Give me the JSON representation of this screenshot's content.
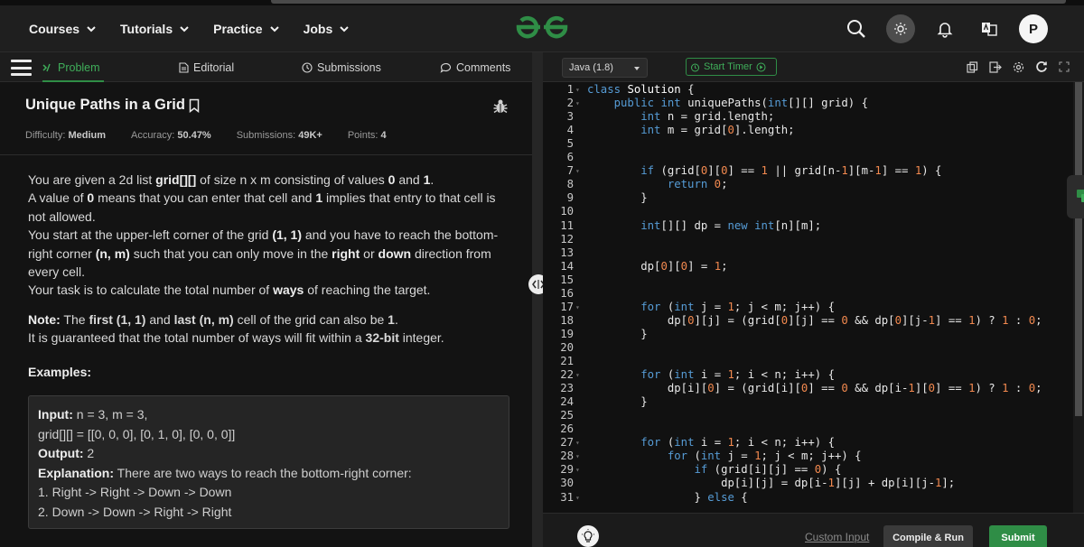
{
  "navbar": {
    "menu": [
      {
        "label": "Courses"
      },
      {
        "label": "Tutorials"
      },
      {
        "label": "Practice"
      },
      {
        "label": "Jobs"
      }
    ],
    "avatar_initial": "P"
  },
  "colors": {
    "brand_green": "#2f8d46",
    "background": "#131313",
    "keyword_blue": "#569cd6",
    "number_orange": "#f2894f"
  },
  "left_tabs": {
    "problem": "Problem",
    "editorial": "Editorial",
    "submissions": "Submissions",
    "comments": "Comments"
  },
  "problem": {
    "title": "Unique Paths in a Grid",
    "meta": {
      "difficulty_label": "Difficulty:",
      "difficulty": "Medium",
      "accuracy_label": "Accuracy:",
      "accuracy": "50.47%",
      "submissions_label": "Submissions:",
      "submissions": "49K+",
      "points_label": "Points:",
      "points": "4"
    },
    "description": {
      "p1": [
        "You are given a 2d list ",
        "grid[][]",
        " of size n x m consisting of values ",
        "0",
        " and ",
        "1",
        "."
      ],
      "p2": [
        "A value of ",
        "0",
        " means that you can enter that cell and ",
        "1",
        " implies that entry to that cell is not allowed."
      ],
      "p3": [
        "You start at the upper-left corner of the grid ",
        "(1, 1)",
        " and you have to reach the bottom-right corner ",
        "(n, m)",
        " such that you can only move in the ",
        "right",
        " or ",
        "down",
        " direction from every cell."
      ],
      "p4": [
        "Your task is to calculate the total number of ",
        "ways",
        " of reaching the target."
      ]
    },
    "note": {
      "label": "Note:",
      "l1": [
        " The ",
        "first (1, 1)",
        " and ",
        "last (n, m)",
        " cell of the grid can also be ",
        "1",
        "."
      ],
      "l2": [
        "It is guaranteed that the total number of ways will fit within a ",
        "32-bit",
        " integer."
      ]
    },
    "examples_heading": "Examples:",
    "example": {
      "input_label": "Input:",
      "input_line1": " n = 3, m = 3,",
      "input_line2": "grid[][] = [[0, 0, 0], [0, 1, 0], [0, 0, 0]]",
      "output_label": "Output:",
      "output_value": " 2",
      "explanation_label": "Explanation:",
      "explanation_text": " There are two ways to reach the bottom-right corner:",
      "way1": "1. Right -> Right -> Down -> Down",
      "way2": "2. Down -> Down -> Right -> Right"
    }
  },
  "editor": {
    "language": "Java (1.8)",
    "timer_label": "Start Timer",
    "lines": [
      {
        "n": "1",
        "fold": true,
        "code": "class Solution {"
      },
      {
        "n": "2",
        "fold": true,
        "code": "    public int uniquePaths(int[][] grid) {"
      },
      {
        "n": "3",
        "fold": false,
        "code": "        int n = grid.length;"
      },
      {
        "n": "4",
        "fold": false,
        "code": "        int m = grid[0].length;"
      },
      {
        "n": "5",
        "fold": false,
        "code": ""
      },
      {
        "n": "6",
        "fold": false,
        "code": ""
      },
      {
        "n": "7",
        "fold": true,
        "code": "        if (grid[0][0] == 1 || grid[n-1][m-1] == 1) {"
      },
      {
        "n": "8",
        "fold": false,
        "code": "            return 0;"
      },
      {
        "n": "9",
        "fold": false,
        "code": "        }"
      },
      {
        "n": "10",
        "fold": false,
        "code": ""
      },
      {
        "n": "11",
        "fold": false,
        "code": "        int[][] dp = new int[n][m];"
      },
      {
        "n": "12",
        "fold": false,
        "code": ""
      },
      {
        "n": "13",
        "fold": false,
        "code": ""
      },
      {
        "n": "14",
        "fold": false,
        "code": "        dp[0][0] = 1;"
      },
      {
        "n": "15",
        "fold": false,
        "code": ""
      },
      {
        "n": "16",
        "fold": false,
        "code": ""
      },
      {
        "n": "17",
        "fold": true,
        "code": "        for (int j = 1; j < m; j++) {"
      },
      {
        "n": "18",
        "fold": false,
        "code": "            dp[0][j] = (grid[0][j] == 0 && dp[0][j-1] == 1) ? 1 : 0;"
      },
      {
        "n": "19",
        "fold": false,
        "code": "        }"
      },
      {
        "n": "20",
        "fold": false,
        "code": ""
      },
      {
        "n": "21",
        "fold": false,
        "code": ""
      },
      {
        "n": "22",
        "fold": true,
        "code": "        for (int i = 1; i < n; i++) {"
      },
      {
        "n": "23",
        "fold": false,
        "code": "            dp[i][0] = (grid[i][0] == 0 && dp[i-1][0] == 1) ? 1 : 0;"
      },
      {
        "n": "24",
        "fold": false,
        "code": "        }"
      },
      {
        "n": "25",
        "fold": false,
        "code": ""
      },
      {
        "n": "26",
        "fold": false,
        "code": ""
      },
      {
        "n": "27",
        "fold": true,
        "code": "        for (int i = 1; i < n; i++) {"
      },
      {
        "n": "28",
        "fold": true,
        "code": "            for (int j = 1; j < m; j++) {"
      },
      {
        "n": "29",
        "fold": true,
        "code": "                if (grid[i][j] == 0) {"
      },
      {
        "n": "30",
        "fold": false,
        "code": "                    dp[i][j] = dp[i-1][j] + dp[i][j-1];"
      },
      {
        "n": "31",
        "fold": true,
        "code": "                } else {"
      }
    ],
    "custom_input_label": "Custom Input",
    "compile_label": "Compile & Run",
    "submit_label": "Submit"
  }
}
